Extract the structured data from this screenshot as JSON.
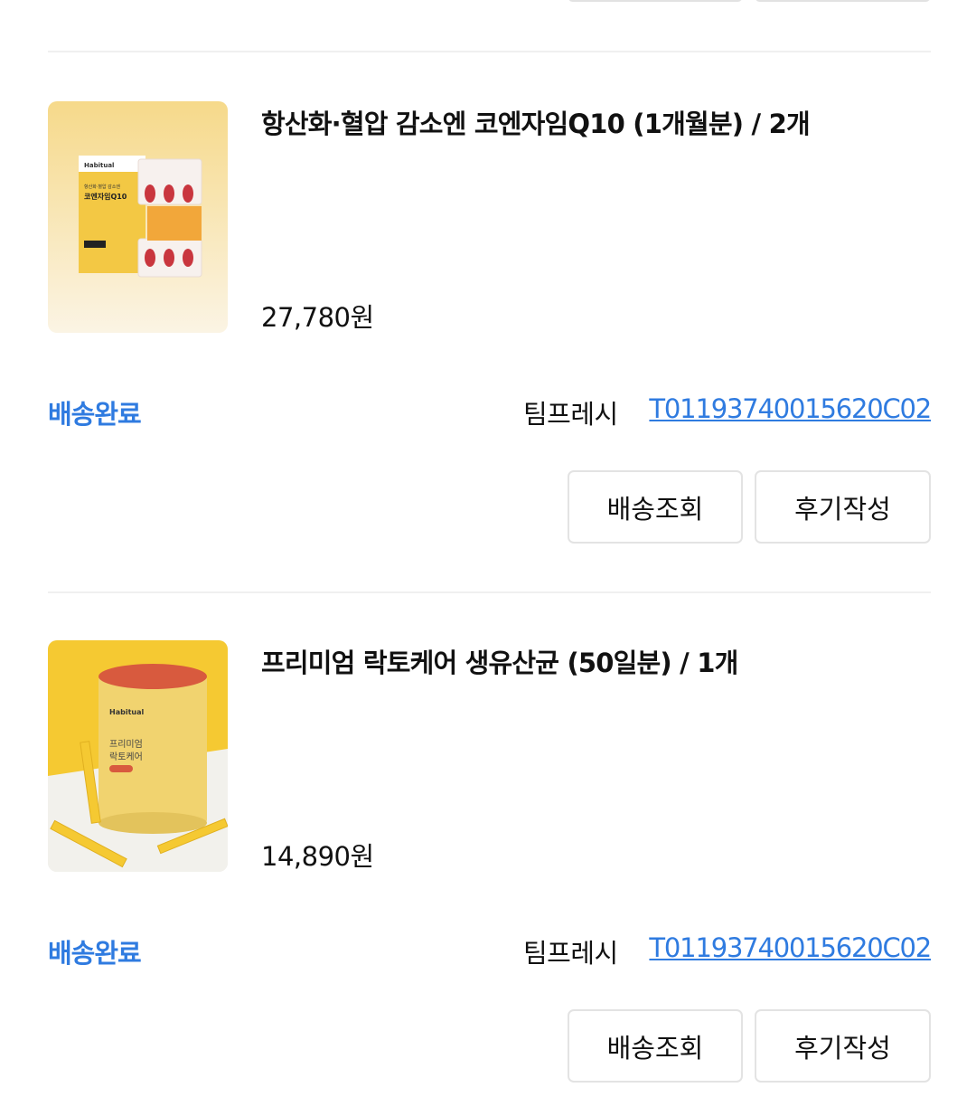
{
  "orders": [
    {
      "title": "항산화·혈압 감소엔 코엔자임Q10 (1개월분) / 2개",
      "price": "27,780원",
      "status": "배송완료",
      "carrier": "팀프레시",
      "tracking_number": "T01193740015620C02",
      "track_button": "배송조회",
      "review_button": "후기작성",
      "image": {
        "brand": "Habitual",
        "subtitle": "항산화·혈압 감소엔",
        "name": "코엔자임Q10"
      }
    },
    {
      "title": "프리미엄 락토케어 생유산균 (50일분) / 1개",
      "price": "14,890원",
      "status": "배송완료",
      "carrier": "팀프레시",
      "tracking_number": "T01193740015620C02",
      "track_button": "배송조회",
      "review_button": "후기작성",
      "image": {
        "brand": "Habitual",
        "name_line1": "프리미엄",
        "name_line2": "락토케어"
      }
    }
  ],
  "colors": {
    "accent": "#2f7be0",
    "divider": "#f0f0f0",
    "button_border": "#e3e3e3"
  }
}
